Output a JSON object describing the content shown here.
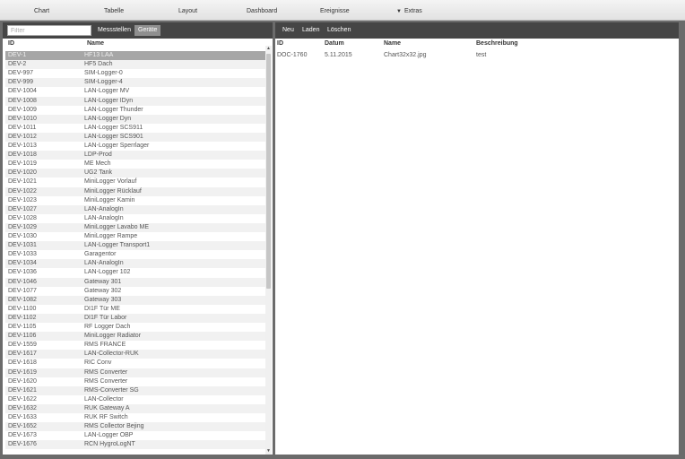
{
  "menu": {
    "items": [
      "Chart",
      "Tabelle",
      "Layout",
      "Dashboard",
      "Ereignisse"
    ],
    "extras": {
      "icon": "triangle-down-icon",
      "label": "Extras"
    }
  },
  "left_panel": {
    "filter_placeholder": "Filter",
    "tabs": [
      {
        "label": "Messstellen",
        "active": false
      },
      {
        "label": "Geräte",
        "active": true
      }
    ],
    "headers": [
      "ID",
      "Name"
    ],
    "rows": [
      [
        "DEV-1",
        "HF13 LAA"
      ],
      [
        "DEV-2",
        "HF5 Dach"
      ],
      [
        "DEV-997",
        "SIM-Logger-0"
      ],
      [
        "DEV-999",
        "SIM-Logger-4"
      ],
      [
        "DEV-1004",
        "LAN-Logger MV"
      ],
      [
        "DEV-1008",
        "LAN-Logger IDyn"
      ],
      [
        "DEV-1009",
        "LAN-Logger Thunder"
      ],
      [
        "DEV-1010",
        "LAN-Logger Dyn"
      ],
      [
        "DEV-1011",
        "LAN-Logger SCS911"
      ],
      [
        "DEV-1012",
        "LAN-Logger SCS901"
      ],
      [
        "DEV-1013",
        "LAN-Logger Sperrlager"
      ],
      [
        "DEV-1018",
        "LDP-Prod"
      ],
      [
        "DEV-1019",
        "ME Mech"
      ],
      [
        "DEV-1020",
        "UG2 Tank"
      ],
      [
        "DEV-1021",
        "MiniLogger Vorlauf"
      ],
      [
        "DEV-1022",
        "MiniLogger Rücklauf"
      ],
      [
        "DEV-1023",
        "MiniLogger Kamin"
      ],
      [
        "DEV-1027",
        "LAN-AnalogIn"
      ],
      [
        "DEV-1028",
        "LAN-AnalogIn"
      ],
      [
        "DEV-1029",
        "MiniLogger Lavabo ME"
      ],
      [
        "DEV-1030",
        "MiniLogger Rampe"
      ],
      [
        "DEV-1031",
        "LAN-Logger Transport1"
      ],
      [
        "DEV-1033",
        "Garagentor"
      ],
      [
        "DEV-1034",
        "LAN-AnalogIn"
      ],
      [
        "DEV-1036",
        "LAN-Logger 102"
      ],
      [
        "DEV-1046",
        "Gateway 301"
      ],
      [
        "DEV-1077",
        "Gateway 302"
      ],
      [
        "DEV-1082",
        "Gateway 303"
      ],
      [
        "DEV-1100",
        "DI1F Tür ME"
      ],
      [
        "DEV-1102",
        "DI1F Tür Labor"
      ],
      [
        "DEV-1105",
        "RF Logger Dach"
      ],
      [
        "DEV-1106",
        "MiniLogger Radiator"
      ],
      [
        "DEV-1559",
        "RMS FRANCE"
      ],
      [
        "DEV-1617",
        "LAN-Collector-RUK"
      ],
      [
        "DEV-1618",
        "RIC Conv"
      ],
      [
        "DEV-1619",
        "RMS Converter"
      ],
      [
        "DEV-1620",
        "RMS Converter"
      ],
      [
        "DEV-1621",
        "RMS-Converter SG"
      ],
      [
        "DEV-1622",
        "LAN-Collector"
      ],
      [
        "DEV-1632",
        "RUK Gateway A"
      ],
      [
        "DEV-1633",
        "RUK RF Switch"
      ],
      [
        "DEV-1652",
        "RMS Collector Bejing"
      ],
      [
        "DEV-1673",
        "LAN-Logger OBP"
      ],
      [
        "DEV-1676",
        "RCN HygroLogNT"
      ]
    ],
    "selected_index": 0
  },
  "right_panel": {
    "toolbar": [
      "Neu",
      "Laden",
      "Löschen"
    ],
    "headers": [
      "ID",
      "Datum",
      "Name",
      "Beschreibung"
    ],
    "rows": [
      [
        "DOC-1760",
        "5.11.2015",
        "Chart32x32.jpg",
        "test"
      ]
    ]
  },
  "icons": {
    "scroll_up": "arrow-up-icon",
    "scroll_down": "arrow-down-icon"
  }
}
